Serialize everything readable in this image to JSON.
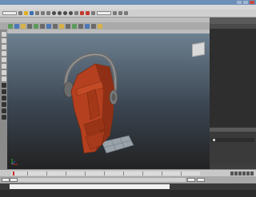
{
  "window": {
    "title": "",
    "controls": [
      "minimize-icon",
      "maximize-icon",
      "close-icon"
    ]
  },
  "menubar": {
    "items": []
  },
  "shelf": {
    "tabs": [],
    "active_tab_index": 5
  },
  "panel_menu": {
    "items": []
  },
  "channel_box": {
    "header": "",
    "sub_items": []
  },
  "layer_editor": {
    "tabs": [],
    "layers": [
      {
        "name": ""
      }
    ]
  },
  "time_slider": {
    "start": "",
    "end": ""
  },
  "range_slider": {
    "start": "",
    "end": ""
  },
  "command_line": {
    "language": ""
  },
  "help_line": {
    "text": ""
  },
  "colors": {
    "model": "#b5401f",
    "headphones": "#7b7b7b",
    "ground_plane": "#9aa2aa",
    "timeline_cursor": "#c62828",
    "active_shelf_tab": "#8fa3c2"
  }
}
